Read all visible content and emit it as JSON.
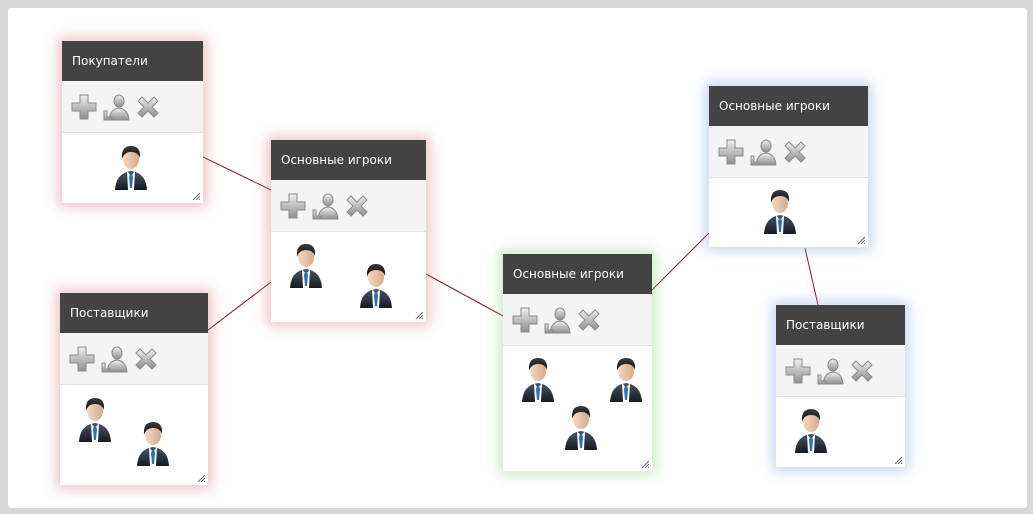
{
  "colors": {
    "header": "#434343",
    "toolbar": "#f4f4f4",
    "link": "#8b1a22",
    "glow_red": "#dc7882",
    "glow_green": "#8cd278",
    "glow_blue": "#82a5d7"
  },
  "icons": [
    "add-icon",
    "user-icon",
    "delete-icon"
  ],
  "cards": [
    {
      "title": "Покупатели"
    },
    {
      "title": "Основные игроки"
    },
    {
      "title": "Поставщики"
    },
    {
      "title": "Основные игроки"
    },
    {
      "title": "Основные игроки"
    },
    {
      "title": "Поставщики"
    }
  ]
}
